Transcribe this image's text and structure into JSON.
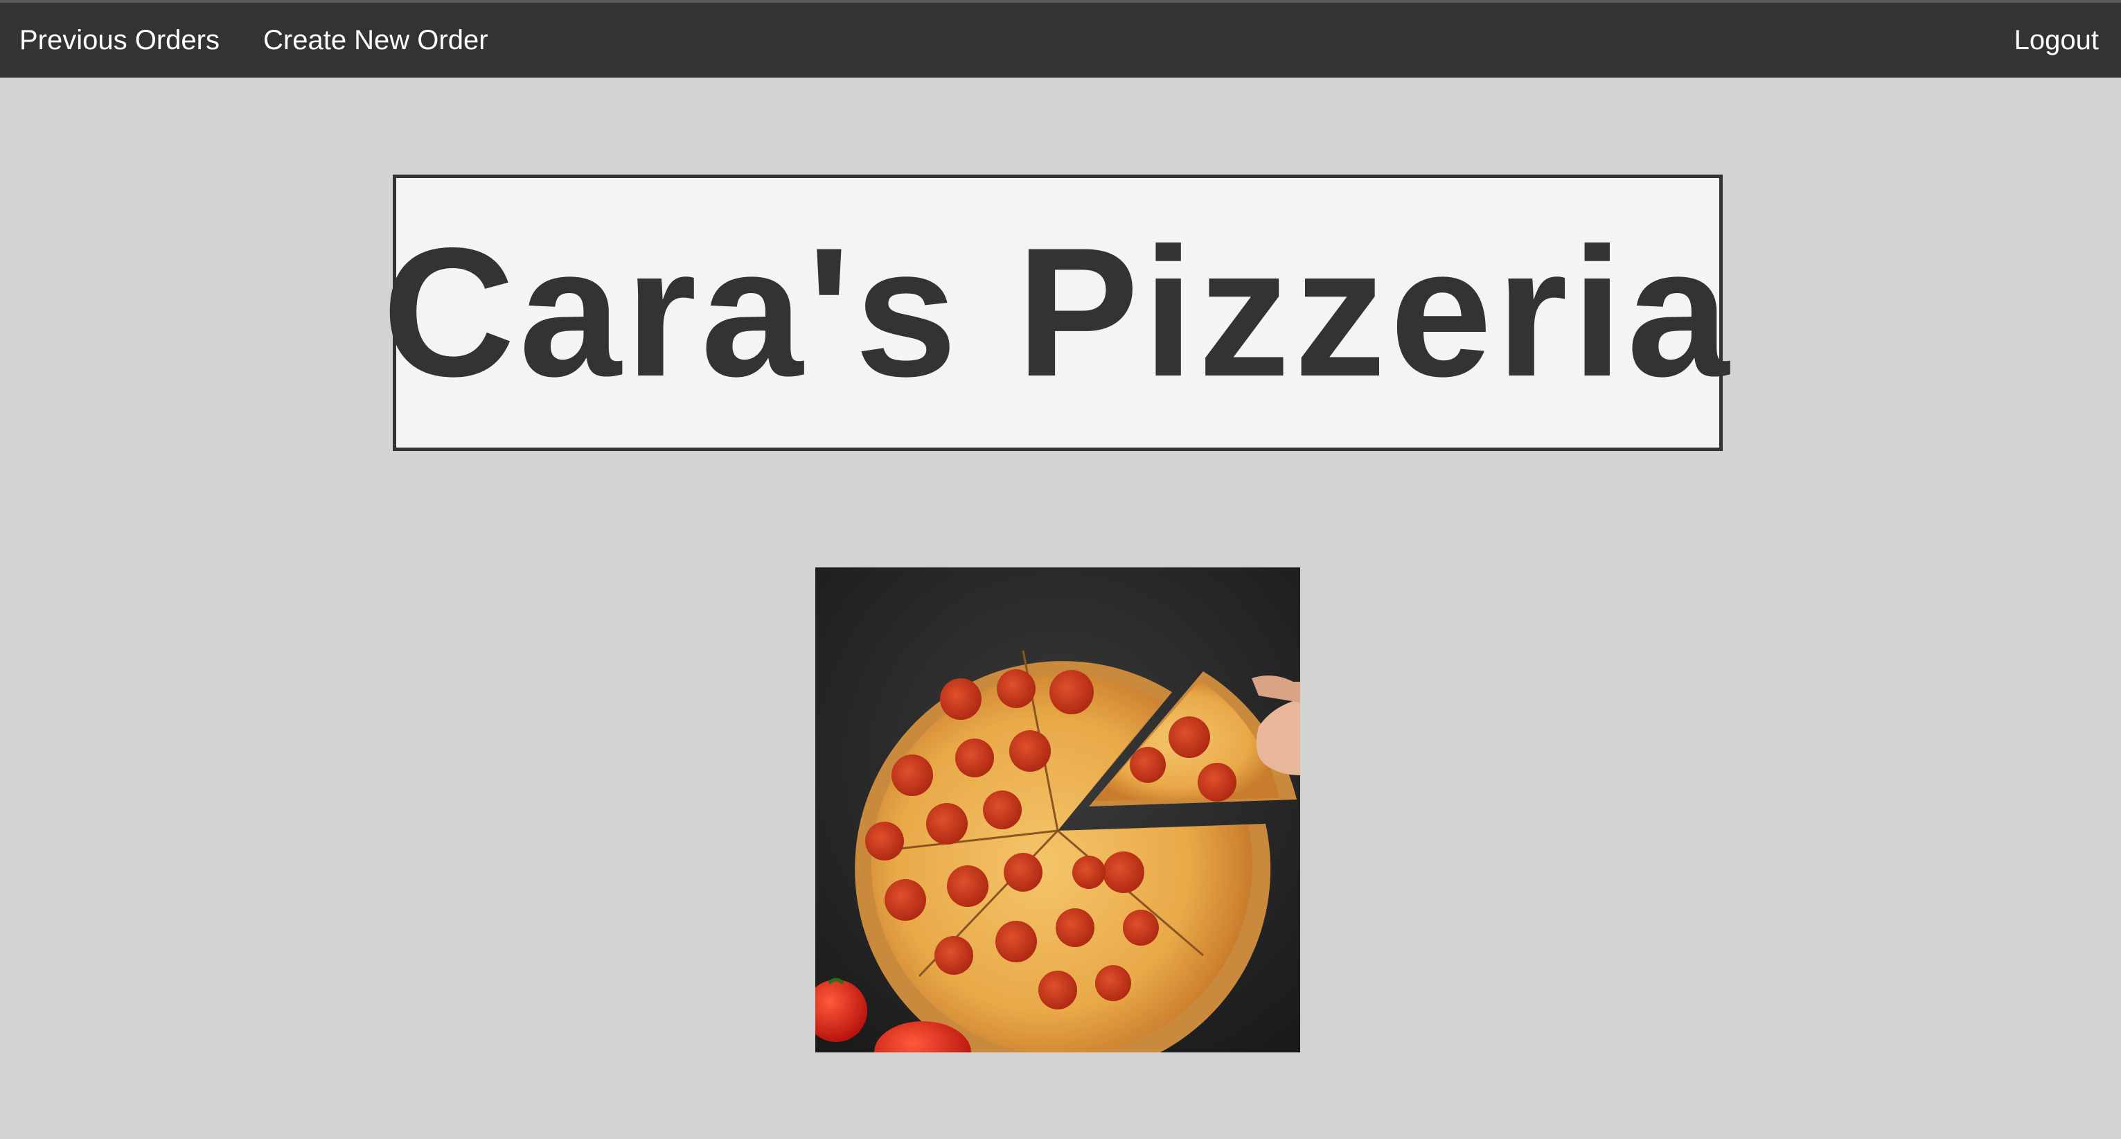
{
  "nav": {
    "previous_orders": "Previous Orders",
    "create_new_order": "Create New Order",
    "logout": "Logout"
  },
  "header": {
    "title": "Cara's Pizzeria"
  },
  "hero_image": {
    "alt": "Cara's Pizzeria",
    "icon": "pepperoni-pizza-photo"
  },
  "colors": {
    "nav_bg": "#333333",
    "page_bg": "#d3d3d3",
    "title_box_bg": "#f4f4f4",
    "title_text": "#333333"
  }
}
